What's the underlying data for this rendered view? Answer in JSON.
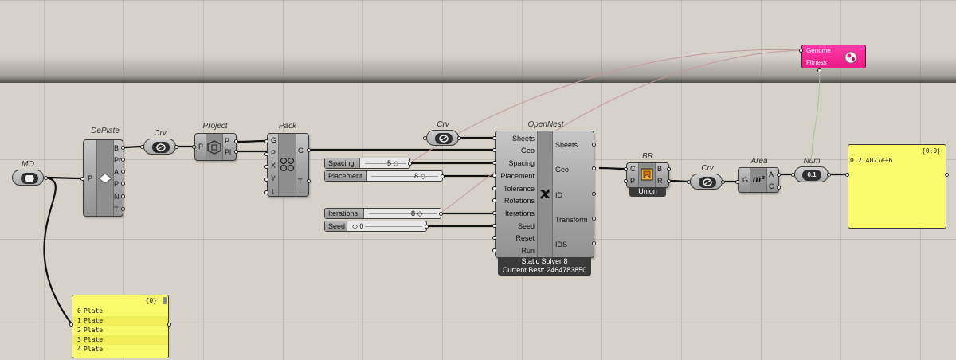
{
  "components": {
    "mo": {
      "nick": "MO"
    },
    "deplate": {
      "nick": "DePlate",
      "input": "P",
      "outputs": [
        "B",
        "Pr",
        "A",
        "P",
        "N",
        "T"
      ]
    },
    "crv1": {
      "nick": "Crv"
    },
    "project": {
      "nick": "Project",
      "input": "P",
      "outputs": [
        "P",
        "Pl"
      ]
    },
    "pack": {
      "nick": "Pack",
      "inputs": [
        "G",
        "P",
        "X",
        "Y",
        "t"
      ],
      "outputs": [
        "G",
        "T"
      ]
    },
    "crv2": {
      "nick": "Crv"
    },
    "opennest": {
      "nick": "OpenNest",
      "inputs": [
        "Sheets",
        "Geo",
        "Spacing",
        "Placement",
        "Tolerance",
        "Rotations",
        "Iterations",
        "Seed",
        "Reset",
        "Run"
      ],
      "outputs": [
        "Sheets",
        "Geo",
        "ID",
        "Transform",
        "IDS"
      ],
      "status_line1": "Static Solver 8",
      "status_line2": "Current Best: 2464783850"
    },
    "br": {
      "nick": "BR",
      "inputs": [
        "C",
        "P"
      ],
      "outputs": [
        "B",
        "R"
      ],
      "footer": "Union"
    },
    "crv3": {
      "nick": "Crv"
    },
    "area": {
      "nick": "Area",
      "input": "G",
      "outputs": [
        "A",
        "C"
      ],
      "symbol": "m²"
    },
    "num": {
      "nick": "Num",
      "glyph": "0.1"
    },
    "galapagos": {
      "genome": "Genome",
      "fitness": "Fitness"
    }
  },
  "sliders": {
    "spacing": {
      "name": "Spacing",
      "value": "5 ◇"
    },
    "placement": {
      "name": "Placement",
      "value": "8 ◇"
    },
    "iterations": {
      "name": "Iterations",
      "value": "8 ◇"
    },
    "seed": {
      "name": "Seed",
      "value": "◇ 0"
    }
  },
  "panels": {
    "plates": {
      "path": "{0}",
      "rows": [
        {
          "index": "0",
          "value": "Plate"
        },
        {
          "index": "1",
          "value": "Plate"
        },
        {
          "index": "2",
          "value": "Plate"
        },
        {
          "index": "3",
          "value": "Plate"
        },
        {
          "index": "4",
          "value": "Plate"
        }
      ]
    },
    "result": {
      "path": "{0;0}",
      "rows": [
        {
          "index": "0",
          "value": "2.4027e+6"
        }
      ]
    }
  },
  "colors": {
    "canvas": "#d6d2ca",
    "component": "#a6a6a6",
    "panel": "#fafa6a",
    "galapagos": "#ea1a86",
    "wire": "#111111"
  },
  "icons": {
    "mo": "mesh-param-icon",
    "deplate": "deplate-diamond-icon",
    "crv": "curve-param-icon",
    "project": "project-icon",
    "pack": "pack-circles-icon",
    "opennest": "opennest-leaf-icon",
    "br": "boundary-union-icon",
    "area": "area-icon",
    "num": "number-param-icon",
    "galapagos": "galapagos-icon"
  }
}
